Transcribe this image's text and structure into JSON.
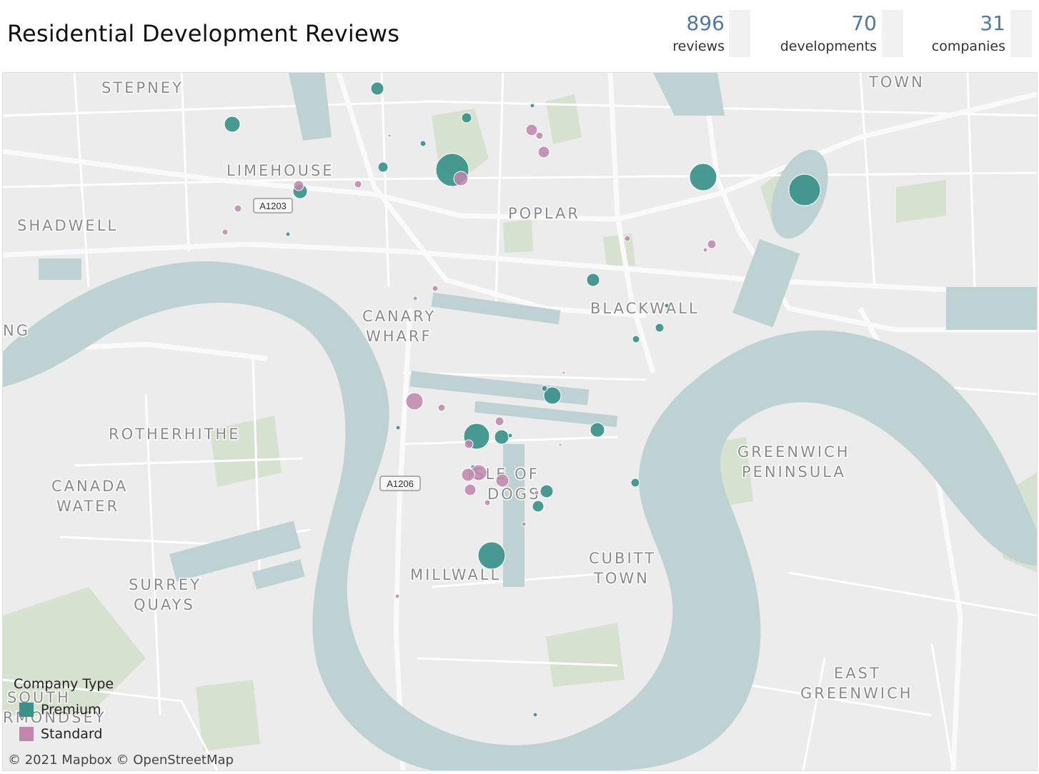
{
  "header": {
    "title": "Residential Development Reviews",
    "kpis": [
      {
        "value": "896",
        "label": "reviews"
      },
      {
        "value": "70",
        "label": "developments"
      },
      {
        "value": "31",
        "label": "companies"
      }
    ]
  },
  "map": {
    "place_labels": [
      "STEPNEY",
      "LIMEHOUSE",
      "SHADWELL",
      "POPLAR",
      "TOWN",
      "CANARY",
      "WHARF",
      "BLACKWALL",
      "NG",
      "ROTHERHITHE",
      "CANADA",
      "WATER",
      "GREENWICH",
      "PENINSULA",
      "ISLE OF",
      "DOGS",
      "CUBITT",
      "TOWN",
      "MILLWALL",
      "SURREY",
      "QUAYS",
      "EAST",
      "GREENWICH",
      "SOUTH",
      "RMONDSEY"
    ],
    "road_labels": [
      "A1203",
      "A1206"
    ],
    "credit": "© 2021 Mapbox  © OpenStreetMap"
  },
  "legend": {
    "title": "Company Type",
    "items": [
      {
        "label": "Premium",
        "color": "#3a9189"
      },
      {
        "label": "Standard",
        "color": "#c086ad"
      }
    ]
  }
}
